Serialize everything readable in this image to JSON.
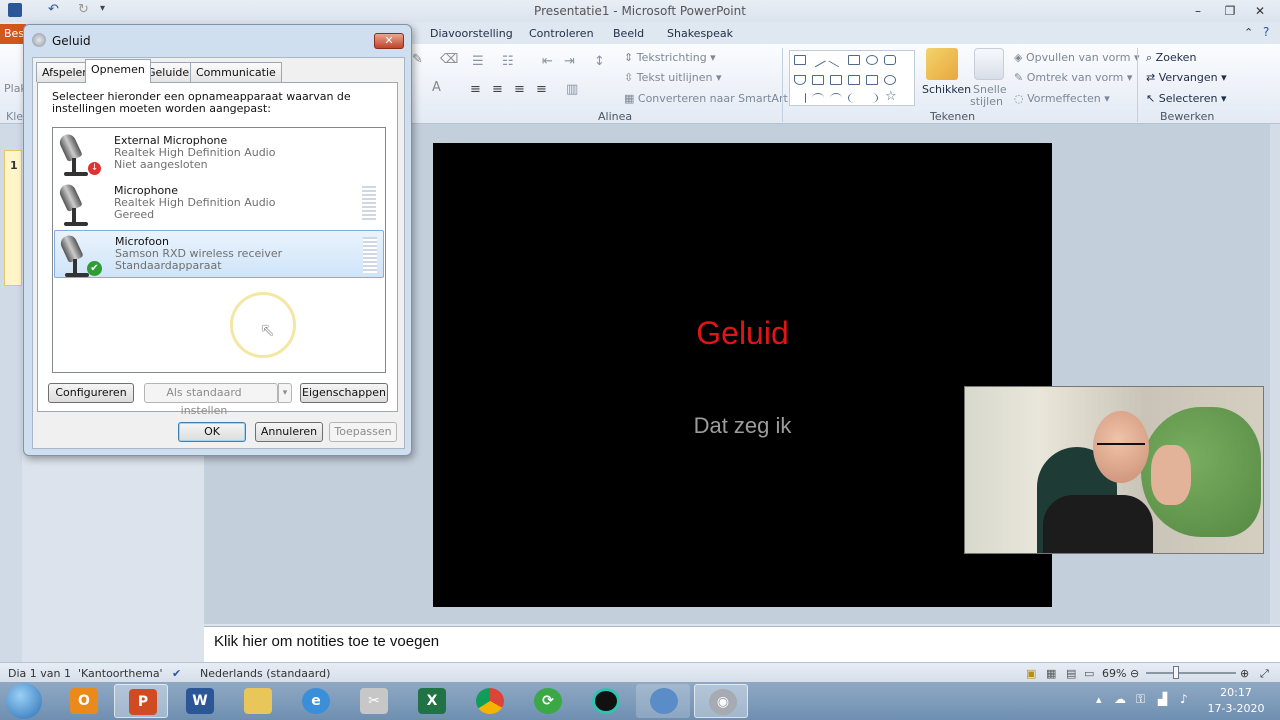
{
  "window": {
    "title": "Presentatie1 - Microsoft PowerPoint"
  },
  "ribbon": {
    "tabs": [
      "Diavoorstelling",
      "Controleren",
      "Beeld",
      "Shakespeak"
    ],
    "file_tab_partial": "Bes",
    "left_partial": [
      "Plak",
      "Kle"
    ],
    "alinea": {
      "group": "Alinea",
      "tekstrichting": "Tekstrichting",
      "tekst_uitlijnen": "Tekst uitlijnen",
      "smartart": "Converteren naar SmartArt"
    },
    "tekenen": {
      "group": "Tekenen",
      "schikken": "Schikken",
      "snelle1": "Snelle",
      "snelle2": "stijlen",
      "opvullen": "Opvullen van vorm",
      "omtrek": "Omtrek van vorm",
      "vormeffecten": "Vormeffecten"
    },
    "bewerken": {
      "group": "Bewerken",
      "zoeken": "Zoeken",
      "vervangen": "Vervangen",
      "selecteren": "Selecteren"
    }
  },
  "slides_pane": {
    "slide_number": "1"
  },
  "slide": {
    "title": "Geluid",
    "subtitle": "Dat zeg ik"
  },
  "notes": {
    "placeholder": "Klik hier om notities toe te voegen"
  },
  "statusbar": {
    "slide": "Dia 1 van 1",
    "theme": "'Kantoorthema'",
    "language": "Nederlands (standaard)",
    "zoom": "69%"
  },
  "dialog": {
    "title": "Geluid",
    "tabs": [
      "Afspelen",
      "Opnemen",
      "Geluiden",
      "Communicatie"
    ],
    "active_tab": "Opnemen",
    "instruction": "Selecteer hieronder een opnameapparaat waarvan de instellingen moeten worden aangepast:",
    "devices": [
      {
        "name": "External Microphone",
        "driver": "Realtek High Definition Audio",
        "status": "Niet aangesloten"
      },
      {
        "name": "Microphone",
        "driver": "Realtek High Definition Audio",
        "status": "Gereed"
      },
      {
        "name": "Microfoon",
        "driver": "Samson RXD wireless receiver",
        "status": "Standaardapparaat"
      }
    ],
    "buttons": {
      "configure": "Configureren",
      "set_default": "Als standaard instellen",
      "properties": "Eigenschappen",
      "ok": "OK",
      "cancel": "Annuleren",
      "apply": "Toepassen"
    }
  },
  "taskbar": {
    "time": "20:17",
    "date": "17-3-2020"
  },
  "colors": {
    "slide_title": "#e01515",
    "accent": "#2b579a"
  }
}
